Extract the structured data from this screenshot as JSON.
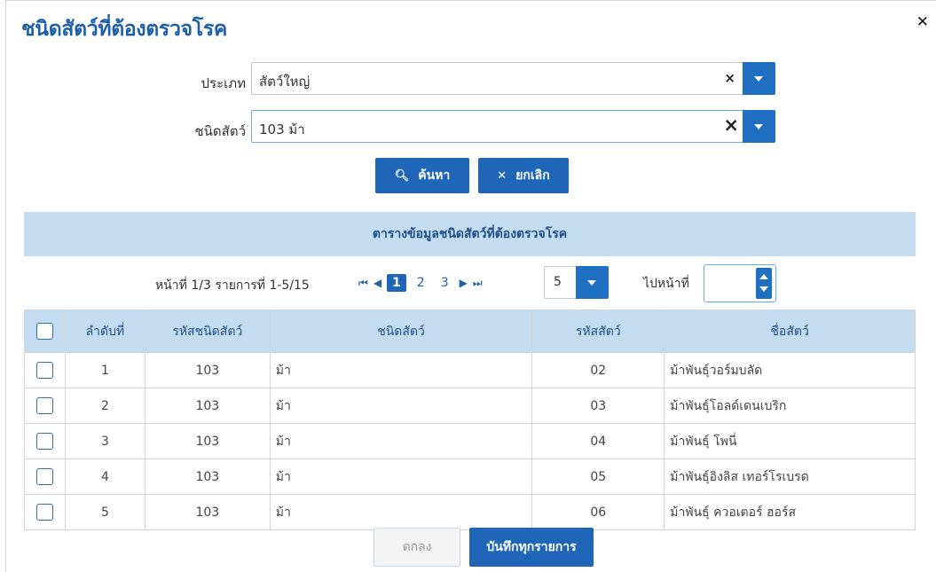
{
  "dialog": {
    "title": "ชนิดสัตว์ที่ต้องตรวจโรค",
    "close_icon": "close-icon"
  },
  "form": {
    "type_label": "ประเภท",
    "type_value": "สัตว์ใหญ่",
    "species_label": "ชนิดสัตว์",
    "species_value": "103 ม้า",
    "search_label": "ค้นหา",
    "cancel_label": "ยกเลิก"
  },
  "grid": {
    "heading": "ตารางข้อมูลชนิดสัตว์ที่ต้องตรวจโรค",
    "pager": {
      "info": "หน้าที่ 1/3 รายการที่ 1-5/15",
      "pages": [
        "1",
        "2",
        "3"
      ],
      "current_page": "1",
      "page_size": "5",
      "goto_label": "ไปหน้าที่",
      "goto_value": ""
    },
    "columns": [
      "ลำดับที่",
      "รหัสชนิดสัตว์",
      "ชนิดสัตว์",
      "รหัสสัตว์",
      "ชื่อสัตว์"
    ],
    "rows": [
      {
        "no": "1",
        "type_code": "103",
        "type_name": "ม้า",
        "code": "02",
        "name": "ม้าพันธุ์วอร์มบลัด"
      },
      {
        "no": "2",
        "type_code": "103",
        "type_name": "ม้า",
        "code": "03",
        "name": "ม้าพันธุ์โอลด์เดนเบริก"
      },
      {
        "no": "3",
        "type_code": "103",
        "type_name": "ม้า",
        "code": "04",
        "name": "ม้าพันธุ์ โพนี่"
      },
      {
        "no": "4",
        "type_code": "103",
        "type_name": "ม้า",
        "code": "05",
        "name": "ม้าพันธุ์อิงลิส เทอร์โรเบรด"
      },
      {
        "no": "5",
        "type_code": "103",
        "type_name": "ม้า",
        "code": "06",
        "name": "ม้าพันธุ์ ควอเตอร์ ฮอร์ส"
      }
    ]
  },
  "footer": {
    "ok_label": "ตกลง",
    "save_all_label": "บันทึกทุกรายการ"
  },
  "colors": {
    "primary": "#1f66b8",
    "header_bg": "#c4dcf0",
    "title": "#1f5fa8"
  }
}
